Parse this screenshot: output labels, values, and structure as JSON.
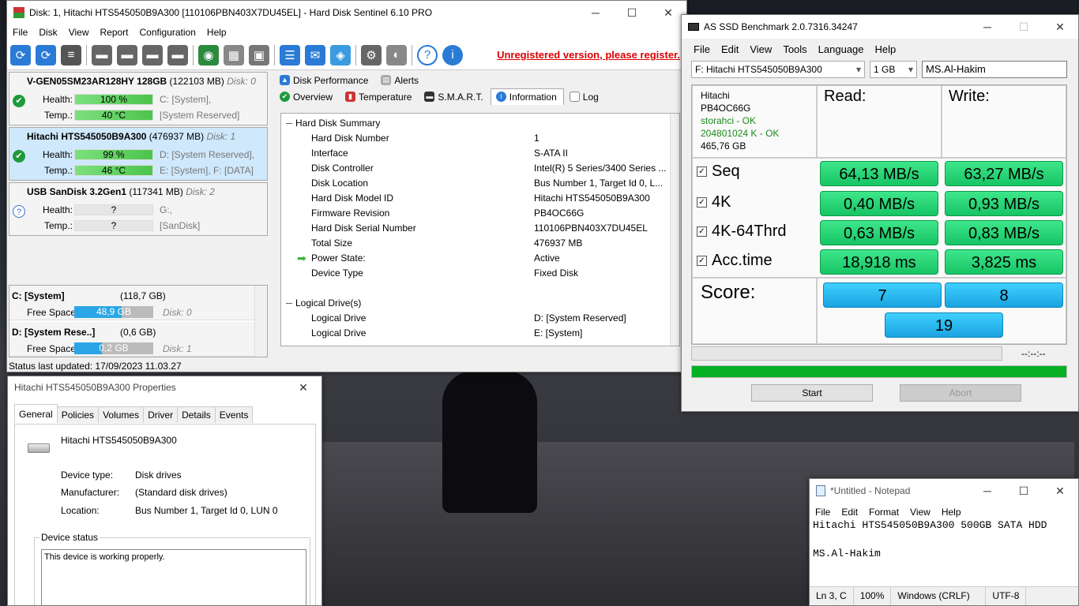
{
  "hds": {
    "title": "Disk: 1, Hitachi HTS545050B9A300 [110106PBN403X7DU45EL]  -  Hard Disk Sentinel 6.10 PRO",
    "menu": [
      "File",
      "Disk",
      "View",
      "Report",
      "Configuration",
      "Help"
    ],
    "unregistered": "Unregistered version, please register.",
    "disks": [
      {
        "name": "V-GEN05SM23AR128HY 128GB",
        "size": "(122103 MB)",
        "dn": "Disk: 0",
        "health": "100 %",
        "temp": "40 °C",
        "h_aux": "C: [System],",
        "t_aux": "[System Reserved]",
        "icon": "ok"
      },
      {
        "name": "Hitachi HTS545050B9A300",
        "size": "(476937 MB)",
        "dn": "Disk: 1",
        "health": "99 %",
        "temp": "46 °C",
        "h_aux": "D: [System Reserved],",
        "t_aux": "E: [System], F: [DATA]",
        "icon": "ok"
      },
      {
        "name": "USB SanDisk 3.2Gen1",
        "size": "(117341 MB)",
        "dn": "Disk: 2",
        "health": "?",
        "temp": "?",
        "h_aux": "G:,",
        "t_aux": "[SanDisk]",
        "icon": "q"
      }
    ],
    "health_label": "Health:",
    "temp_label": "Temp.:",
    "drives": [
      {
        "name": "C: [System]",
        "size": "(118,7 GB)",
        "free": "48,9 GB",
        "disk": "Disk: 0"
      },
      {
        "name": "D: [System Rese..]",
        "size": "(0,6 GB)",
        "free": "0,2 GB",
        "disk": "Disk: 1"
      }
    ],
    "free_label": "Free Space",
    "status": "Status last updated: 17/09/2023 11.03.27",
    "tabs_top": [
      "Disk Performance",
      "Alerts"
    ],
    "tabs_bottom": [
      "Overview",
      "Temperature",
      "S.M.A.R.T.",
      "Information",
      "Log"
    ],
    "summary_title": "Hard Disk Summary",
    "summary": [
      {
        "k": "Hard Disk Number",
        "v": "1"
      },
      {
        "k": "Interface",
        "v": "S-ATA II"
      },
      {
        "k": "Disk Controller",
        "v": "Intel(R) 5 Series/3400 Series ..."
      },
      {
        "k": "Disk Location",
        "v": "Bus Number 1, Target Id 0, L..."
      },
      {
        "k": "Hard Disk Model ID",
        "v": "Hitachi HTS545050B9A300"
      },
      {
        "k": "Firmware Revision",
        "v": "PB4OC66G"
      },
      {
        "k": "Hard Disk Serial Number",
        "v": "110106PBN403X7DU45EL"
      },
      {
        "k": "Total Size",
        "v": "476937 MB"
      },
      {
        "k": "Power State:",
        "v": "Active"
      },
      {
        "k": "Device Type",
        "v": "Fixed Disk"
      }
    ],
    "logical_title": "Logical Drive(s)",
    "logical": [
      {
        "k": "Logical Drive",
        "v": "D: [System Reserved]"
      },
      {
        "k": "Logical Drive",
        "v": "E: [System]"
      }
    ]
  },
  "props": {
    "title": "Hitachi HTS545050B9A300 Properties",
    "tabs": [
      "General",
      "Policies",
      "Volumes",
      "Driver",
      "Details",
      "Events"
    ],
    "device": "Hitachi HTS545050B9A300",
    "rows": [
      {
        "k": "Device type:",
        "v": "Disk drives"
      },
      {
        "k": "Manufacturer:",
        "v": "(Standard disk drives)"
      },
      {
        "k": "Location:",
        "v": "Bus Number 1, Target Id 0, LUN 0"
      }
    ],
    "status_legend": "Device status",
    "status_text": "This device is working properly."
  },
  "asssd": {
    "title": "AS SSD Benchmark 2.0.7316.34247",
    "menu": [
      "File",
      "Edit",
      "View",
      "Tools",
      "Language",
      "Help"
    ],
    "drive": "F: Hitachi HTS545050B9A300",
    "size": "1 GB",
    "name": "MS.Al-Hakim",
    "info": [
      "Hitachi",
      "PB4OC66G",
      "storahci - OK",
      "204801024 K - OK",
      "465,76 GB"
    ],
    "read_label": "Read:",
    "write_label": "Write:",
    "tests": [
      {
        "name": "Seq",
        "read": "64,13 MB/s",
        "write": "63,27 MB/s"
      },
      {
        "name": "4K",
        "read": "0,40 MB/s",
        "write": "0,93 MB/s"
      },
      {
        "name": "4K-64Thrd",
        "read": "0,63 MB/s",
        "write": "0,83 MB/s"
      },
      {
        "name": "Acc.time",
        "read": "18,918 ms",
        "write": "3,825 ms"
      }
    ],
    "score_label": "Score:",
    "score_read": "7",
    "score_write": "8",
    "score_total": "19",
    "time": "--:--:--",
    "start": "Start",
    "abort": "Abort",
    "progress": 1.0
  },
  "notepad": {
    "title": "*Untitled - Notepad",
    "menu": [
      "File",
      "Edit",
      "Format",
      "View",
      "Help"
    ],
    "line1": "Hitachi HTS545050B9A300 500GB SATA HDD",
    "line3": "MS.Al-Hakim",
    "pos": "Ln 3, C",
    "zoom": "100%",
    "eol": "Windows (CRLF)",
    "enc": "UTF-8"
  }
}
